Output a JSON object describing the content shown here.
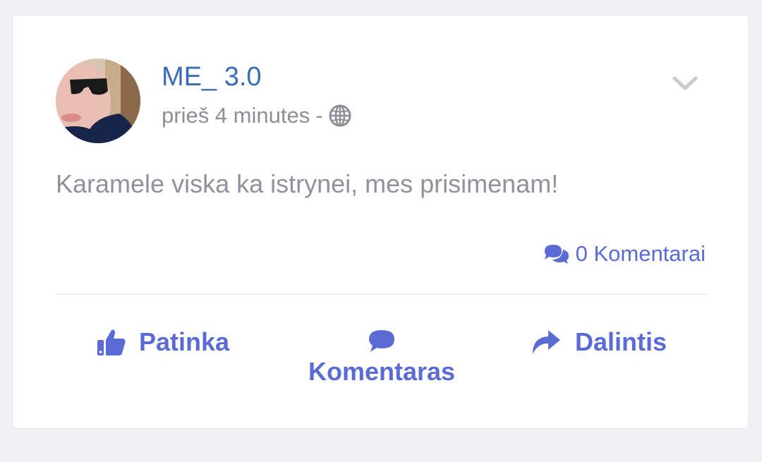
{
  "post": {
    "author": "ME_ 3.0",
    "time": "prieš 4 minutes",
    "separator": "-",
    "visibility_icon": "globe-icon",
    "text": "Karamele viska ka istrynei, mes prisimenam!",
    "comments_count": "0 Komentarai"
  },
  "actions": {
    "like_label": "Patinka",
    "comment_label": "Komentaras",
    "share_label": "Dalintis"
  },
  "colors": {
    "accent": "#5b6bd6",
    "author": "#3a6bb5",
    "muted_text": "#8f929c",
    "background": "#f1f0f2"
  }
}
